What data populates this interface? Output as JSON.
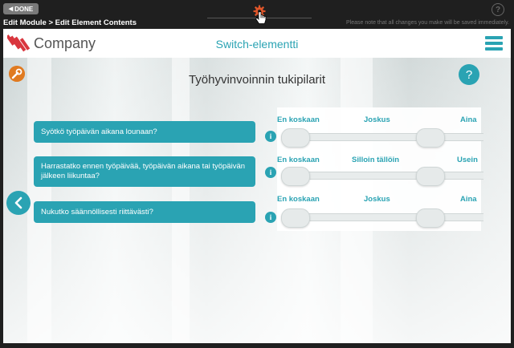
{
  "toolbar": {
    "done_label": "DONE",
    "breadcrumb": "Edit Module > Edit Element Contents",
    "notice": "Please note that all changes you make will be saved immediately.",
    "help": "?"
  },
  "app": {
    "company": "Company",
    "module_title": "Switch-elementti",
    "page_title": "Työhyvinvoinnin tukipilarit",
    "help": "?"
  },
  "questions": [
    {
      "text": "Syötkö työpäivän aikana lounaan?",
      "left": "En koskaan",
      "middle": "Joskus",
      "right": "Aina"
    },
    {
      "text": "Harrastatko ennen työpäivää, työpäivän aikana tai työpäivän jälkeen liikuntaa?",
      "left": "En koskaan",
      "middle": "Silloin tällöin",
      "right": "Usein"
    },
    {
      "text": "Nukutko säännöllisesti riittävästi?",
      "left": "En koskaan",
      "middle": "Joskus",
      "right": "Aina"
    }
  ],
  "info_glyph": "i",
  "colors": {
    "accent": "#2aa3b3",
    "settings": "#e07a20",
    "logo": "#d9363e"
  }
}
